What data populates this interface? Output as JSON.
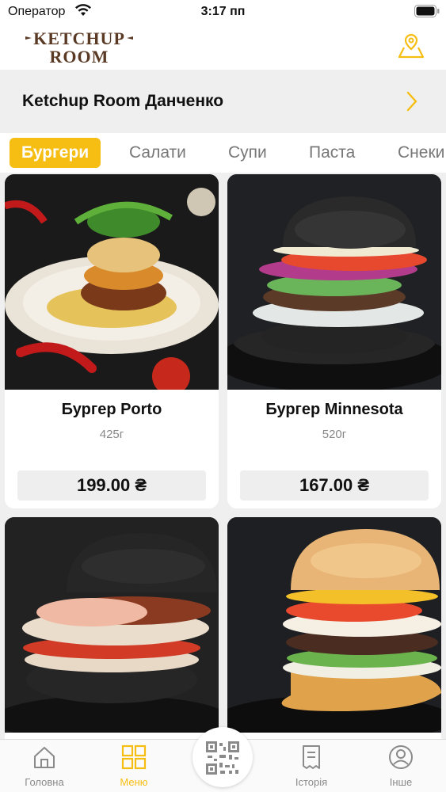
{
  "status_bar": {
    "carrier": "Оператор",
    "time": "3:17 пп"
  },
  "header": {
    "logo_text_line1": "KETCHUP",
    "logo_text_line2": "ROOM",
    "location_icon": "map-pin-icon"
  },
  "restaurant": {
    "name": "Ketchup Room Данченко"
  },
  "tabs": [
    {
      "label": "Бургери",
      "active": true
    },
    {
      "label": "Салати",
      "active": false
    },
    {
      "label": "Супи",
      "active": false
    },
    {
      "label": "Паста",
      "active": false
    },
    {
      "label": "Снеки",
      "active": false
    }
  ],
  "products": [
    {
      "name": "Бургер Porto",
      "weight": "425г",
      "price": "199.00 ₴",
      "bun": "light"
    },
    {
      "name": "Бургер Minnesota",
      "weight": "520г",
      "price": "167.00 ₴",
      "bun": "black"
    },
    {
      "name": "",
      "weight": "",
      "price": "",
      "bun": "black"
    },
    {
      "name": "",
      "weight": "",
      "price": "",
      "bun": "sesame"
    }
  ],
  "bottom_nav": {
    "items": [
      {
        "label": "Головна",
        "icon": "home-icon",
        "active": false
      },
      {
        "label": "Меню",
        "icon": "grid-icon",
        "active": true
      },
      {
        "label": "Історія",
        "icon": "receipt-icon",
        "active": false
      },
      {
        "label": "Інше",
        "icon": "user-icon",
        "active": false
      }
    ],
    "center_icon": "qr-code-icon"
  },
  "colors": {
    "accent": "#f6bd12",
    "logo": "#5a3a24",
    "background": "#efefef",
    "inactive": "#8a8a8a"
  }
}
